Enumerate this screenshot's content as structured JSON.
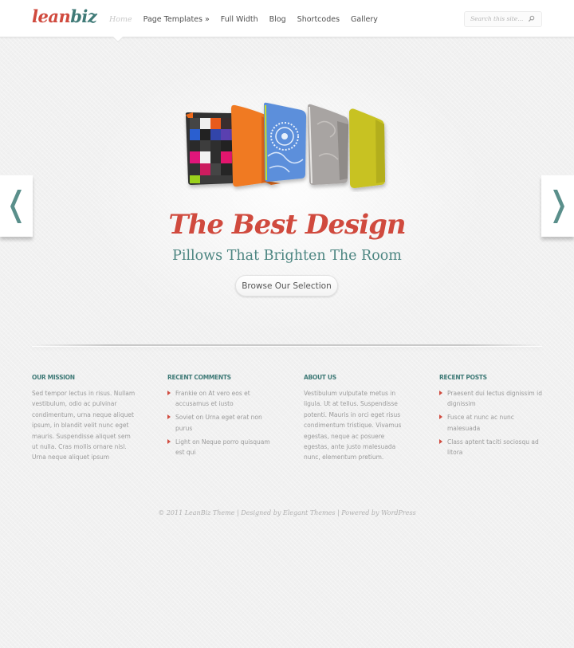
{
  "header": {
    "logo": {
      "part1": "lean",
      "part2": "biz"
    },
    "nav": [
      {
        "label": "Home",
        "active": true
      },
      {
        "label": "Page Templates »",
        "active": false
      },
      {
        "label": "Full Width",
        "active": false
      },
      {
        "label": "Blog",
        "active": false
      },
      {
        "label": "Shortcodes",
        "active": false
      },
      {
        "label": "Gallery",
        "active": false
      }
    ],
    "search": {
      "placeholder": "Search this site...",
      "icon": "search-icon"
    }
  },
  "slider": {
    "image": "pillows-image",
    "title": "The Best Design",
    "subtitle": "Pillows That Brighten The Room",
    "button_label": "Browse Our Selection",
    "prev_icon": "chevron-left-icon",
    "next_icon": "chevron-right-icon"
  },
  "widgets": [
    {
      "title": "Our Mission",
      "text": "Sed tempor lectus in risus. Nullam vestibulum, odio ac pulvinar condimentum, urna neque aliquet ipsum, in blandit velit nunc eget mauris. Suspendisse aliquet sem ut nulla. Cras mollis ornare nisl. Urna neque aliquet ipsum"
    },
    {
      "title": "Recent Comments",
      "items": [
        "Frankie on At vero eos et accusamus et iusto",
        "Soviet on Urna eget erat non purus",
        "Light on Neque porro quisquam est qui"
      ]
    },
    {
      "title": "About Us",
      "text": "Vestibulum vulputate metus in ligula. Ut at tellus. Suspendisse potenti. Mauris in orci eget risus condimentum tristique. Vivamus egestas, neque ac posuere egestas, ante justo malesuada nunc, elementum pretium."
    },
    {
      "title": "Recent Posts",
      "items": [
        "Praesent dui lectus dignissim id dignissim",
        "Fusce at nunc ac nunc malesuada",
        "Class aptent taciti sociosqu ad litora"
      ]
    }
  ],
  "footer": {
    "credits": "© 2011 LeanBiz Theme | Designed by Elegant Themes | Powered by WordPress"
  },
  "colors": {
    "accent_red": "#d04a3e",
    "accent_teal": "#3f7a77",
    "background": "#f1f1f1"
  }
}
